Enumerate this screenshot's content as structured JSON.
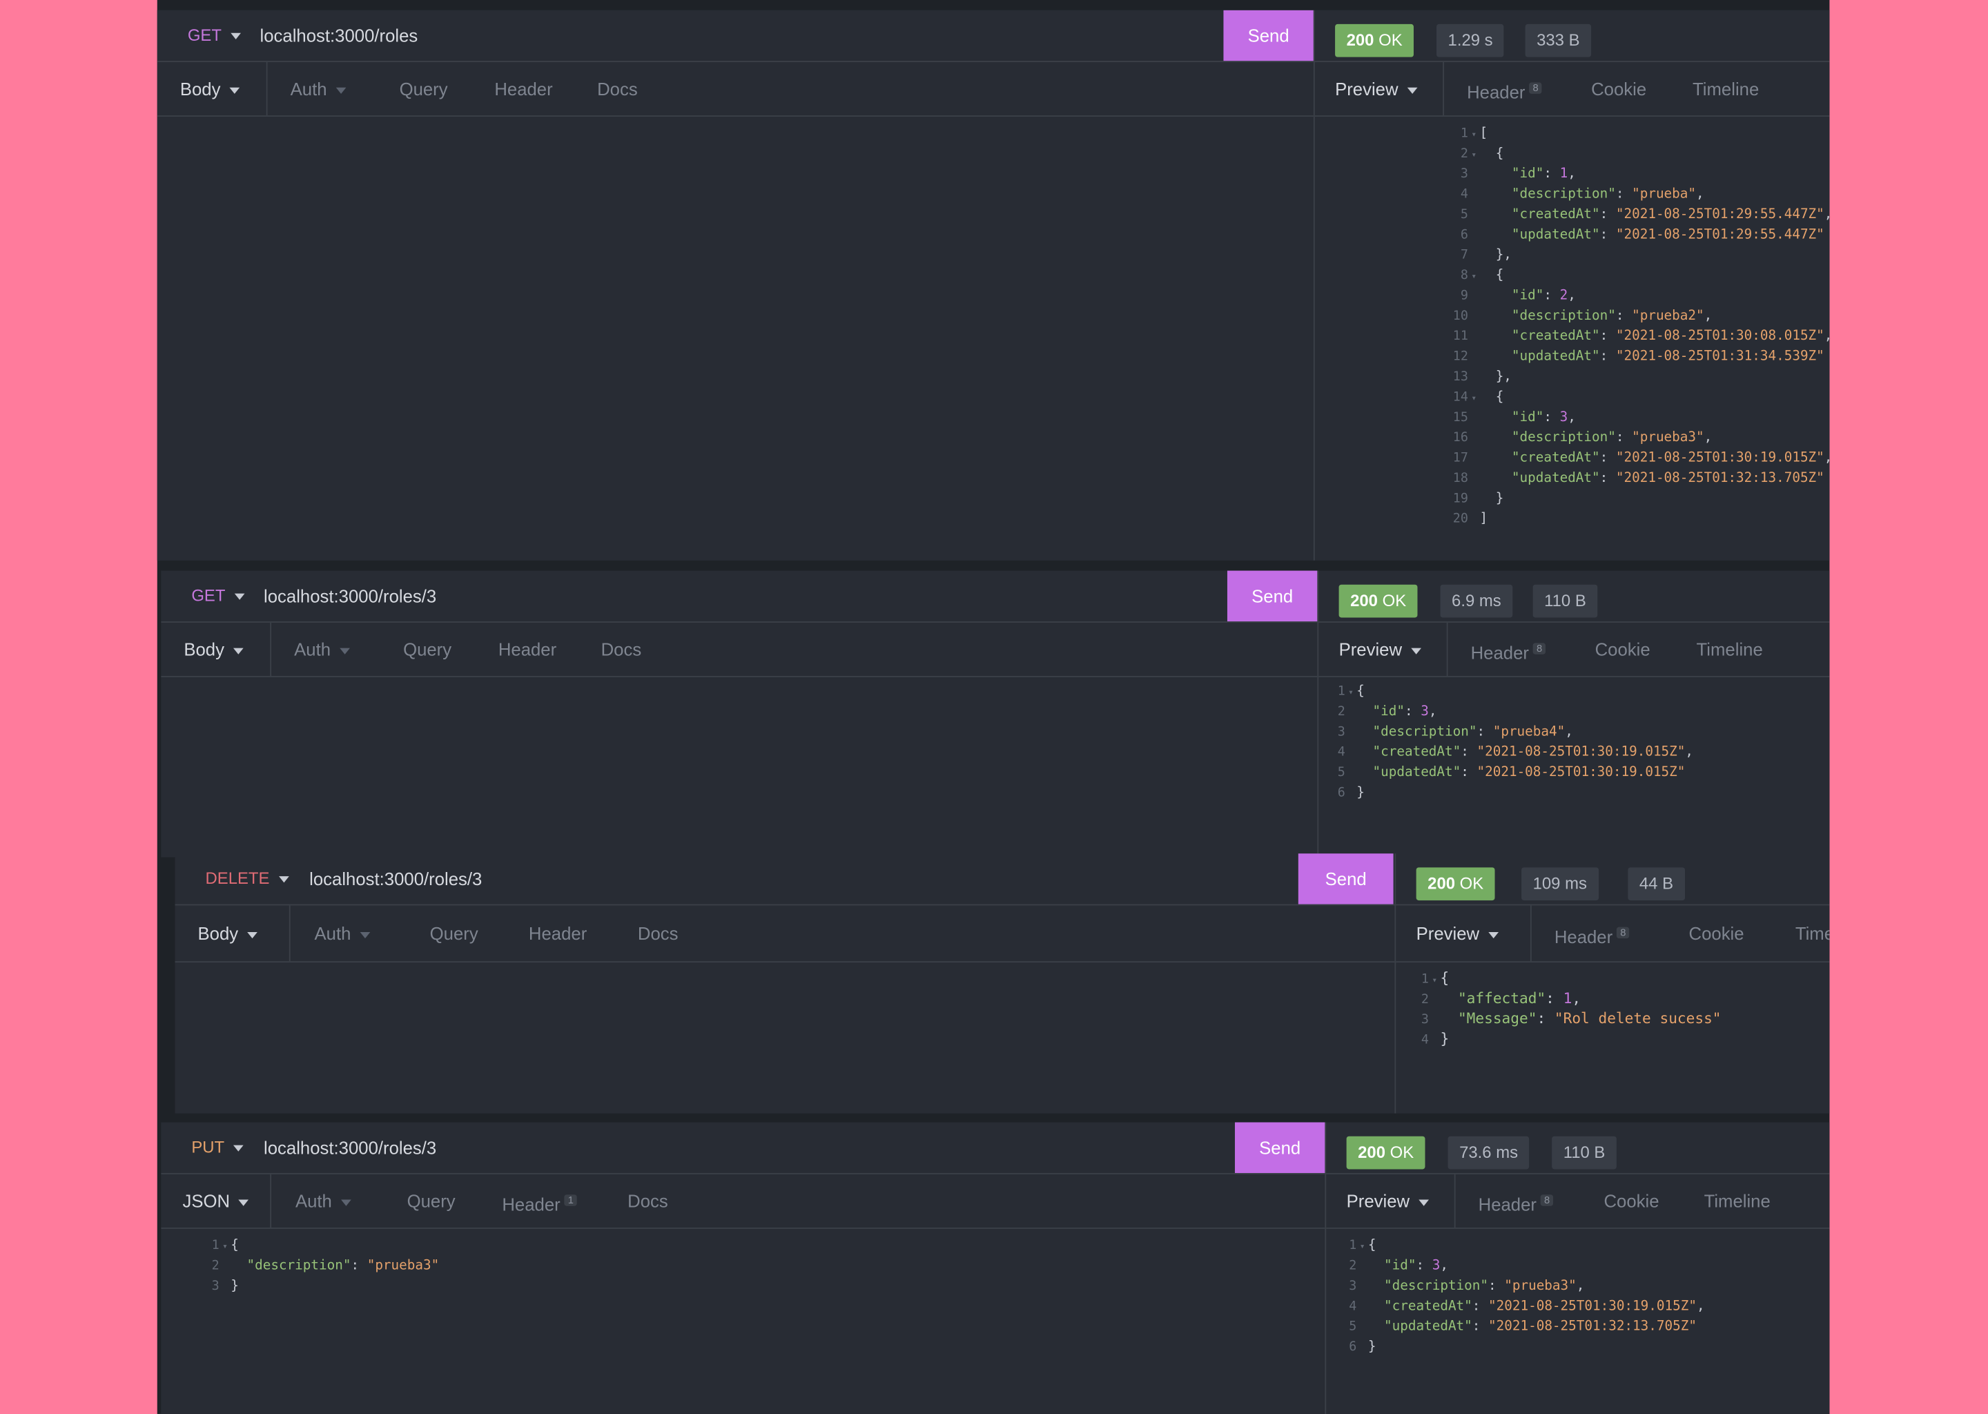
{
  "colors": {
    "background": "#ff7b9c",
    "panel": "#282c34",
    "send": "#c36ee6",
    "ok": "#75ad62",
    "get": "#c678dd",
    "delete": "#e06c75",
    "put": "#e5a26b",
    "key": "#98c379",
    "string": "#e5a26b",
    "number": "#c678dd"
  },
  "requests": [
    {
      "method": "GET",
      "url": "localhost:3000/roles",
      "send": "Send",
      "status_code": "200",
      "status_text": "OK",
      "time": "1.29 s",
      "size": "333 B",
      "req_tabs": {
        "body": "Body",
        "auth": "Auth",
        "query": "Query",
        "header": "Header",
        "docs": "Docs"
      },
      "resp_tabs": {
        "preview": "Preview",
        "header": "Header",
        "header_count": "8",
        "cookie": "Cookie",
        "timeline": "Timeline"
      },
      "response_lines": [
        [
          [
            "p",
            "["
          ]
        ],
        [
          [
            "p",
            "  {"
          ]
        ],
        [
          [
            "k",
            "    \"id\""
          ],
          [
            "p",
            ": "
          ],
          [
            "n",
            "1"
          ],
          [
            "p",
            ","
          ]
        ],
        [
          [
            "k",
            "    \"description\""
          ],
          [
            "p",
            ": "
          ],
          [
            "s",
            "\"prueba\""
          ],
          [
            "p",
            ","
          ]
        ],
        [
          [
            "k",
            "    \"createdAt\""
          ],
          [
            "p",
            ": "
          ],
          [
            "s",
            "\"2021-08-25T01:29:55.447Z\""
          ],
          [
            "p",
            ","
          ]
        ],
        [
          [
            "k",
            "    \"updatedAt\""
          ],
          [
            "p",
            ": "
          ],
          [
            "s",
            "\"2021-08-25T01:29:55.447Z\""
          ]
        ],
        [
          [
            "p",
            "  },"
          ]
        ],
        [
          [
            "p",
            "  {"
          ]
        ],
        [
          [
            "k",
            "    \"id\""
          ],
          [
            "p",
            ": "
          ],
          [
            "n",
            "2"
          ],
          [
            "p",
            ","
          ]
        ],
        [
          [
            "k",
            "    \"description\""
          ],
          [
            "p",
            ": "
          ],
          [
            "s",
            "\"prueba2\""
          ],
          [
            "p",
            ","
          ]
        ],
        [
          [
            "k",
            "    \"createdAt\""
          ],
          [
            "p",
            ": "
          ],
          [
            "s",
            "\"2021-08-25T01:30:08.015Z\""
          ],
          [
            "p",
            ","
          ]
        ],
        [
          [
            "k",
            "    \"updatedAt\""
          ],
          [
            "p",
            ": "
          ],
          [
            "s",
            "\"2021-08-25T01:31:34.539Z\""
          ]
        ],
        [
          [
            "p",
            "  },"
          ]
        ],
        [
          [
            "p",
            "  {"
          ]
        ],
        [
          [
            "k",
            "    \"id\""
          ],
          [
            "p",
            ": "
          ],
          [
            "n",
            "3"
          ],
          [
            "p",
            ","
          ]
        ],
        [
          [
            "k",
            "    \"description\""
          ],
          [
            "p",
            ": "
          ],
          [
            "s",
            "\"prueba3\""
          ],
          [
            "p",
            ","
          ]
        ],
        [
          [
            "k",
            "    \"createdAt\""
          ],
          [
            "p",
            ": "
          ],
          [
            "s",
            "\"2021-08-25T01:30:19.015Z\""
          ],
          [
            "p",
            ","
          ]
        ],
        [
          [
            "k",
            "    \"updatedAt\""
          ],
          [
            "p",
            ": "
          ],
          [
            "s",
            "\"2021-08-25T01:32:13.705Z\""
          ]
        ],
        [
          [
            "p",
            "  }"
          ]
        ],
        [
          [
            "p",
            "]"
          ]
        ]
      ],
      "folds": [
        1,
        2,
        8,
        14
      ]
    },
    {
      "method": "GET",
      "url": "localhost:3000/roles/3",
      "send": "Send",
      "status_code": "200",
      "status_text": "OK",
      "time": "6.9 ms",
      "size": "110 B",
      "req_tabs": {
        "body": "Body",
        "auth": "Auth",
        "query": "Query",
        "header": "Header",
        "docs": "Docs"
      },
      "resp_tabs": {
        "preview": "Preview",
        "header": "Header",
        "header_count": "8",
        "cookie": "Cookie",
        "timeline": "Timeline"
      },
      "response_lines": [
        [
          [
            "p",
            "{"
          ]
        ],
        [
          [
            "k",
            "  \"id\""
          ],
          [
            "p",
            ": "
          ],
          [
            "n",
            "3"
          ],
          [
            "p",
            ","
          ]
        ],
        [
          [
            "k",
            "  \"description\""
          ],
          [
            "p",
            ": "
          ],
          [
            "s",
            "\"prueba4\""
          ],
          [
            "p",
            ","
          ]
        ],
        [
          [
            "k",
            "  \"createdAt\""
          ],
          [
            "p",
            ": "
          ],
          [
            "s",
            "\"2021-08-25T01:30:19.015Z\""
          ],
          [
            "p",
            ","
          ]
        ],
        [
          [
            "k",
            "  \"updatedAt\""
          ],
          [
            "p",
            ": "
          ],
          [
            "s",
            "\"2021-08-25T01:30:19.015Z\""
          ]
        ],
        [
          [
            "p",
            "}"
          ]
        ]
      ],
      "folds": [
        1
      ]
    },
    {
      "method": "DELETE",
      "url": "localhost:3000/roles/3",
      "send": "Send",
      "status_code": "200",
      "status_text": "OK",
      "time": "109 ms",
      "size": "44 B",
      "req_tabs": {
        "body": "Body",
        "auth": "Auth",
        "query": "Query",
        "header": "Header",
        "docs": "Docs"
      },
      "resp_tabs": {
        "preview": "Preview",
        "header": "Header",
        "header_count": "8",
        "cookie": "Cookie",
        "timeline": "Time"
      },
      "response_lines": [
        [
          [
            "p",
            "{"
          ]
        ],
        [
          [
            "k",
            "  \"affectad\""
          ],
          [
            "p",
            ": "
          ],
          [
            "n",
            "1"
          ],
          [
            "p",
            ","
          ]
        ],
        [
          [
            "k",
            "  \"Message\""
          ],
          [
            "p",
            ": "
          ],
          [
            "s",
            "\"Rol delete sucess\""
          ]
        ],
        [
          [
            "p",
            "}"
          ]
        ]
      ],
      "folds": [
        1
      ]
    },
    {
      "method": "PUT",
      "url": "localhost:3000/roles/3",
      "send": "Send",
      "status_code": "200",
      "status_text": "OK",
      "time": "73.6 ms",
      "size": "110 B",
      "req_tabs": {
        "body": "JSON",
        "auth": "Auth",
        "query": "Query",
        "header": "Header",
        "header_count": "1",
        "docs": "Docs"
      },
      "resp_tabs": {
        "preview": "Preview",
        "header": "Header",
        "header_count": "8",
        "cookie": "Cookie",
        "timeline": "Timeline"
      },
      "request_lines": [
        [
          [
            "p",
            "{"
          ]
        ],
        [
          [
            "k",
            "  \"description\""
          ],
          [
            "p",
            ": "
          ],
          [
            "s",
            "\"prueba3\""
          ]
        ],
        [
          [
            "p",
            "}"
          ]
        ]
      ],
      "response_lines": [
        [
          [
            "p",
            "{"
          ]
        ],
        [
          [
            "k",
            "  \"id\""
          ],
          [
            "p",
            ": "
          ],
          [
            "n",
            "3"
          ],
          [
            "p",
            ","
          ]
        ],
        [
          [
            "k",
            "  \"description\""
          ],
          [
            "p",
            ": "
          ],
          [
            "s",
            "\"prueba3\""
          ],
          [
            "p",
            ","
          ]
        ],
        [
          [
            "k",
            "  \"createdAt\""
          ],
          [
            "p",
            ": "
          ],
          [
            "s",
            "\"2021-08-25T01:30:19.015Z\""
          ],
          [
            "p",
            ","
          ]
        ],
        [
          [
            "k",
            "  \"updatedAt\""
          ],
          [
            "p",
            ": "
          ],
          [
            "s",
            "\"2021-08-25T01:32:13.705Z\""
          ]
        ],
        [
          [
            "p",
            "}"
          ]
        ]
      ],
      "folds": [
        1
      ]
    }
  ]
}
